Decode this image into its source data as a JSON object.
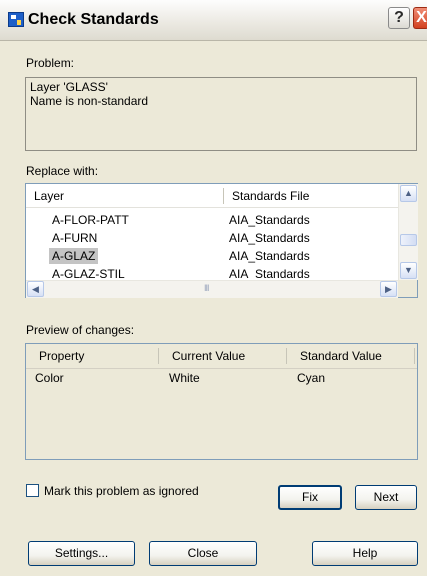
{
  "window": {
    "title": "Check Standards",
    "help_glyph": "?",
    "close_glyph": "X"
  },
  "problem": {
    "label": "Problem:",
    "lines": [
      "Layer 'GLASS'",
      "Name is non-standard"
    ]
  },
  "replace": {
    "label": "Replace with:",
    "columns": [
      "Layer",
      "Standards File"
    ],
    "rows": [
      {
        "layer": "A-FLOR-PATT",
        "file": "AIA_Standards"
      },
      {
        "layer": "A-FURN",
        "file": "AIA_Standards"
      },
      {
        "layer": "A-GLAZ",
        "file": "AIA_Standards"
      },
      {
        "layer": "A-GLAZ-STIL",
        "file": "AIA_Standards"
      }
    ],
    "selected_index": 2
  },
  "preview": {
    "label": "Preview of changes:",
    "columns": [
      "Property",
      "Current Value",
      "Standard Value"
    ],
    "rows": [
      {
        "property": "Color",
        "current": "White",
        "standard": "Cyan"
      }
    ]
  },
  "ignore_checkbox": {
    "label": "Mark this problem as ignored",
    "checked": false
  },
  "buttons": {
    "fix": "Fix",
    "next": "Next",
    "settings": "Settings...",
    "close": "Close",
    "help": "Help"
  },
  "scroll": {
    "up": "▲",
    "down": "▼",
    "left": "◀",
    "right": "▶",
    "grip": "III"
  }
}
